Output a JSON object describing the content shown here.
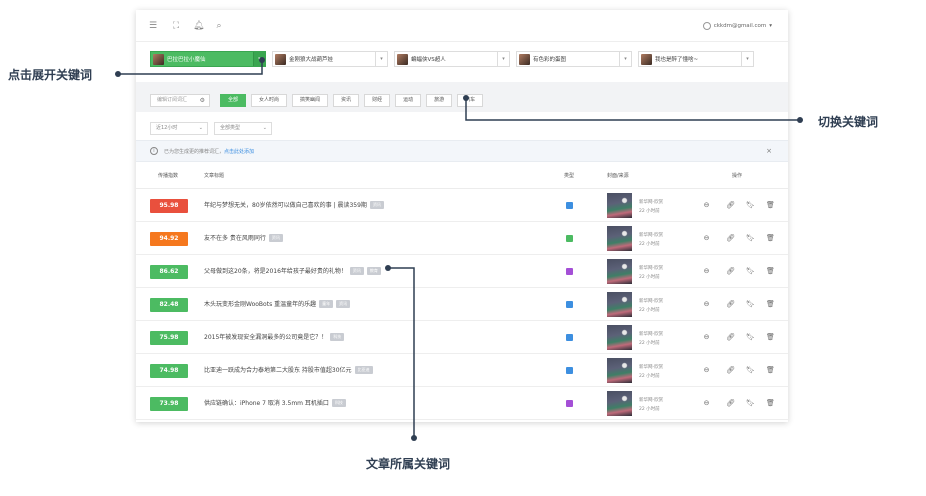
{
  "topbar": {
    "menu_icon": "menu-icon",
    "fullscreen_icon": "expand-icon",
    "bell_icon": "bell-icon",
    "search_icon": "search-icon",
    "user_email": "ckkdm@gmail.com",
    "user_chevron": "▾"
  },
  "keywords": [
    {
      "label": "巴拉巴拉小魔仙",
      "active": true
    },
    {
      "label": "金刚狼大战葫芦娃",
      "active": false
    },
    {
      "label": "蝙蝠侠VS超人",
      "active": false
    },
    {
      "label": "有色彩的蛋图",
      "active": false
    },
    {
      "label": "我也是醉了懂啥~",
      "active": false
    }
  ],
  "filters": {
    "keyword_input_placeholder": "编辑订阅词汇",
    "tabs": [
      "全部",
      "女人时尚",
      "搞笑幽闻",
      "资讯",
      "财经",
      "运动",
      "旅游",
      "汽车"
    ],
    "time_select": "近12小时",
    "type_select": "全部类型"
  },
  "notice": {
    "text": "已为您生成更的推荐词汇，",
    "link": "点击此处添加",
    "close": "×"
  },
  "table": {
    "headers": {
      "score": "传播指数",
      "title": "文章标题",
      "type": "类型",
      "cover": "封面/来源",
      "ops": "操作"
    },
    "rows": [
      {
        "score": "95.98",
        "color": "#e9503d",
        "title": "年纪与梦想无关，80岁依然可以做自己喜欢的事 | 晨读359期",
        "tags": [
          "资讯"
        ],
        "type_color": "#3d8fe0",
        "source": "新华网-欣赏",
        "time": "22 小时前"
      },
      {
        "score": "94.92",
        "color": "#f5781e",
        "title": "友不在多 贵在风雨同行",
        "tags": [
          "资讯"
        ],
        "type_color": "#4cbb62",
        "source": "新华网-欣赏",
        "time": "22 小时前"
      },
      {
        "score": "86.62",
        "color": "#4cbb62",
        "title": "父母做到这20条，将是2016年给孩子最好贵的礼物！",
        "tags": [
          "资讯",
          "教育"
        ],
        "type_color": "#a44fd6",
        "source": "新华网-欣赏",
        "time": "22 小时前"
      },
      {
        "score": "82.48",
        "color": "#4cbb62",
        "title": "木头玩变形金刚WooBots 重温童年的乐趣",
        "tags": [
          "童年",
          "资讯"
        ],
        "type_color": "#3d8fe0",
        "source": "新华网-欣赏",
        "time": "22 小时前"
      },
      {
        "score": "75.98",
        "color": "#4cbb62",
        "title": "2015年被发现安全漏洞最多的公司竟是它？！",
        "tags": [
          "科技"
        ],
        "type_color": "#3d8fe0",
        "source": "新华网-欣赏",
        "time": "22 小时前"
      },
      {
        "score": "74.98",
        "color": "#4cbb62",
        "title": "比亚迪一跃成为合力泰地第二大股东 持股市值超30亿元",
        "tags": [
          "比亚迪"
        ],
        "type_color": "#3d8fe0",
        "source": "新华网-欣赏",
        "time": "22 小时前"
      },
      {
        "score": "73.98",
        "color": "#4cbb62",
        "title": "供应链确认：iPhone 7 取消 3.5mm 耳机插口",
        "tags": [
          "科技"
        ],
        "type_color": "#a44fd6",
        "source": "新华网-欣赏",
        "time": "22 小时前"
      }
    ],
    "op_icons": [
      "globe-icon",
      "link-icon",
      "bookmark-icon",
      "trash-icon"
    ]
  },
  "callouts": {
    "expand_keywords": "点击展开关键词",
    "switch_keywords": "切换关键词",
    "article_keywords": "文章所属关键词"
  }
}
